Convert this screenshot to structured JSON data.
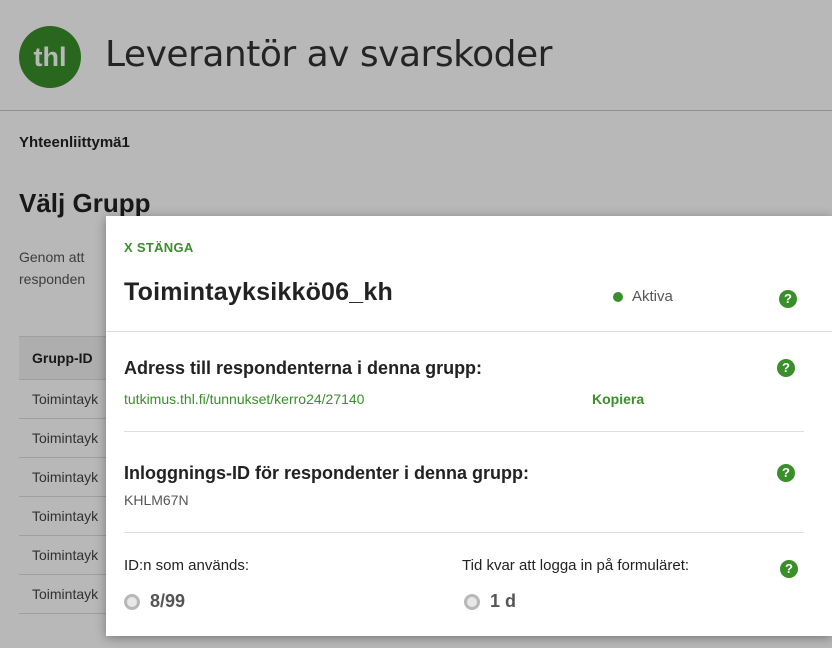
{
  "header": {
    "logo_text": "thl",
    "app_title": "Leverantör av svarskoder"
  },
  "breadcrumb": "Yhteenliittymä1",
  "section": {
    "title": "Välj Grupp",
    "description_line1": "Genom att",
    "description_line2": "responden"
  },
  "table": {
    "header": "Grupp-ID",
    "rows": [
      "Toimintayk",
      "Toimintayk",
      "Toimintayk",
      "Toimintayk",
      "Toimintayk",
      "Toimintayk"
    ]
  },
  "modal": {
    "close_label": "X STÄNGA",
    "group_name": "Toimintayksikkö06_kh",
    "status": "Aktiva",
    "help_glyph": "?",
    "address": {
      "label": "Adress till respondenterna i denna grupp:",
      "url": "tutkimus.thl.fi/tunnukset/kerro24/27140",
      "copy_label": "Kopiera"
    },
    "login": {
      "label": "Inloggnings-ID för respondenter i denna grupp:",
      "value": "KHLM67N"
    },
    "ids_used": {
      "label": "ID:n som används:",
      "value": "8/99"
    },
    "time_left": {
      "label": "Tid kvar att logga in på formuläret:",
      "value": "1 d"
    }
  },
  "colors": {
    "accent": "#3a8f2a",
    "overlay": "rgba(0,0,0,0.28)"
  }
}
